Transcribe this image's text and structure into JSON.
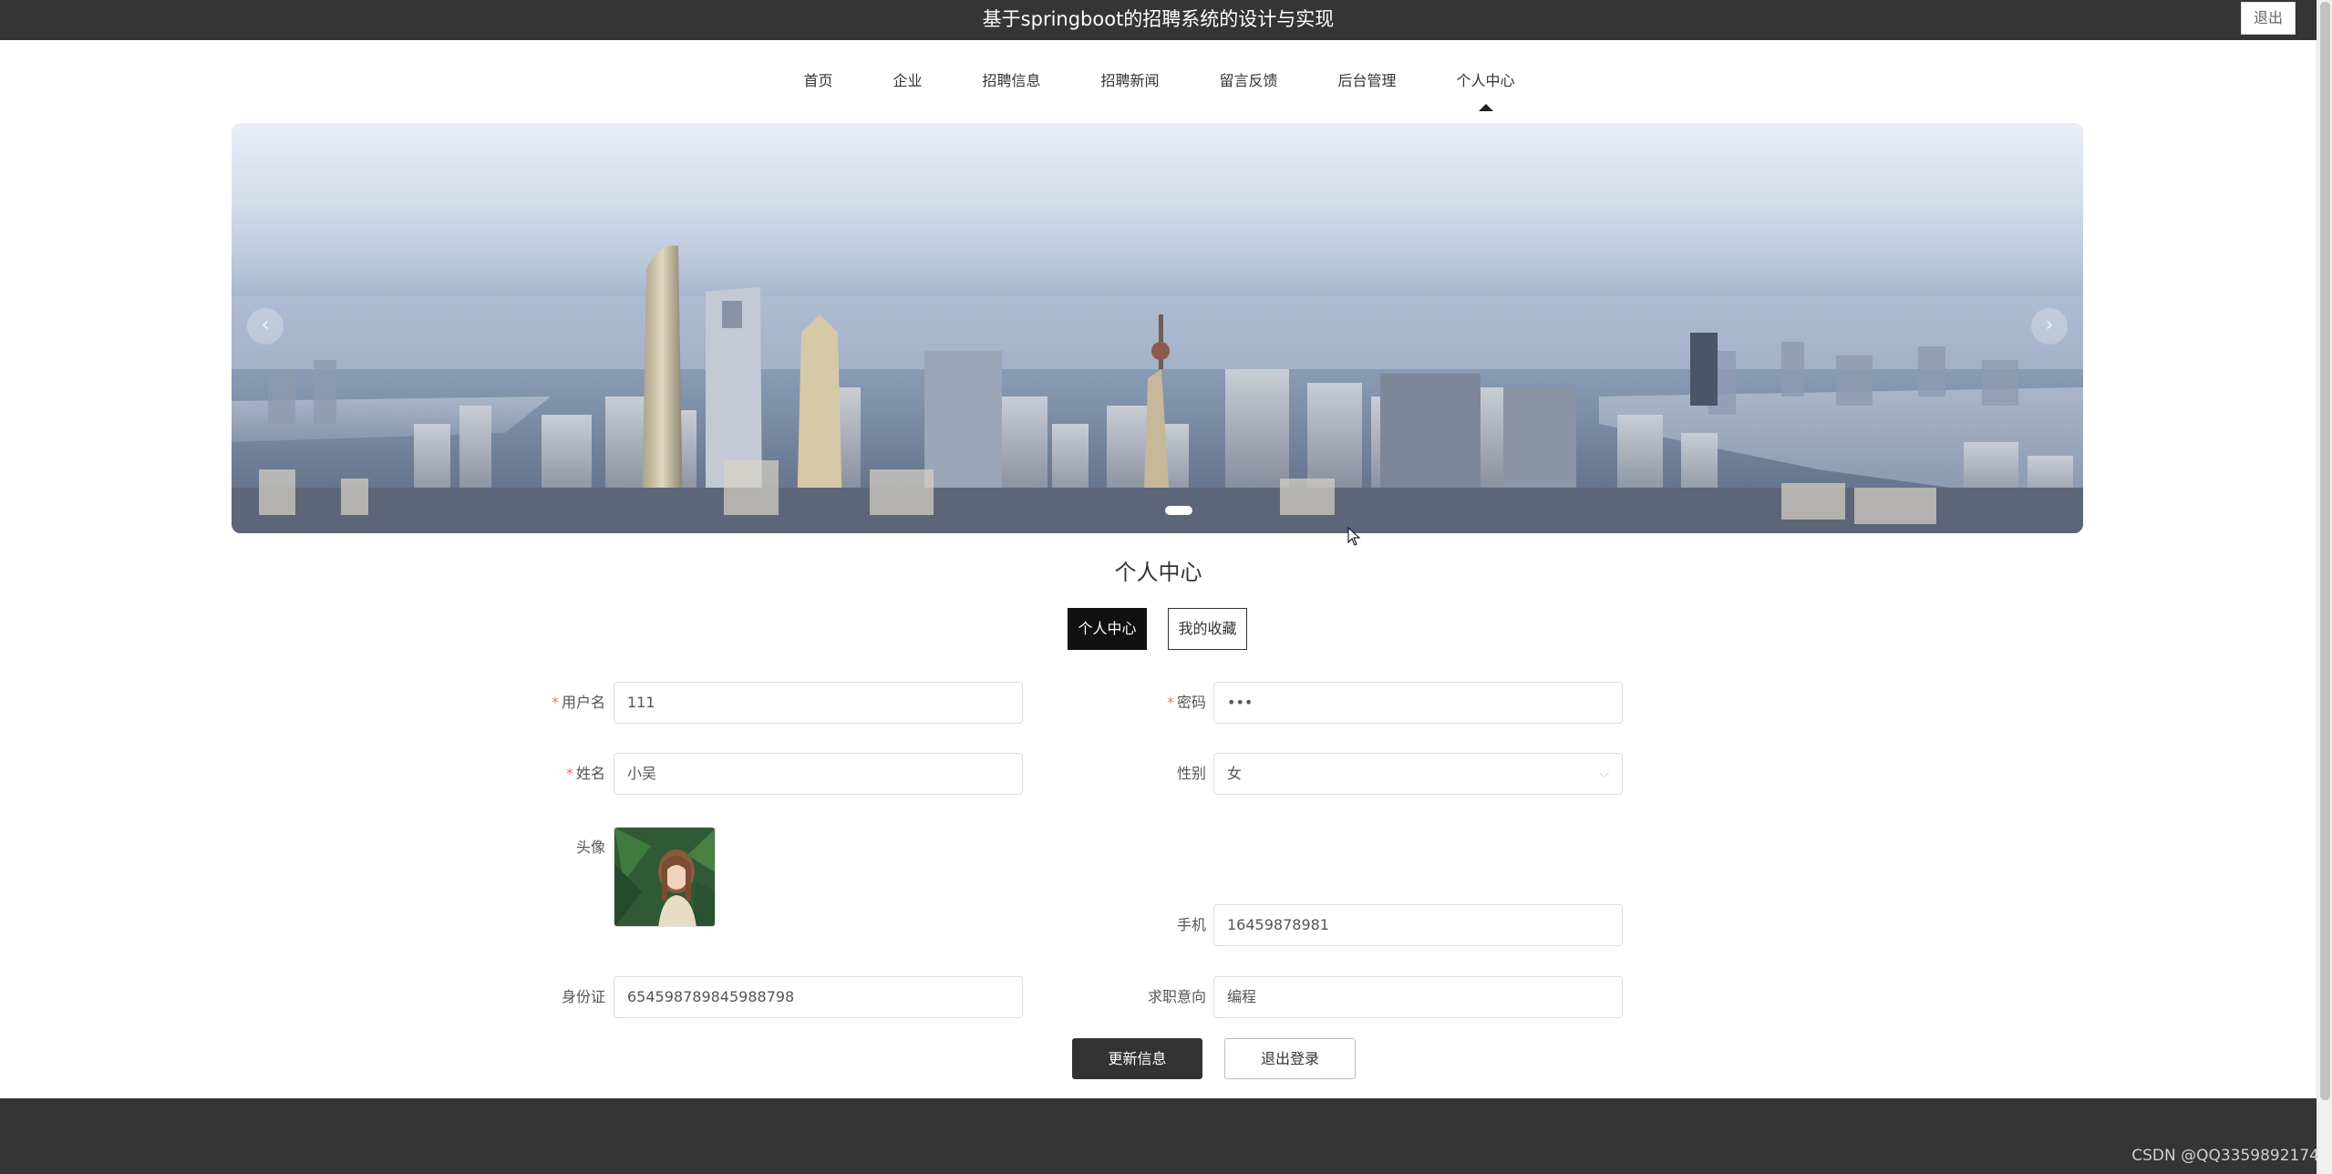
{
  "header": {
    "site_title": "基于springboot的招聘系统的设计与实现",
    "logout_label": "退出"
  },
  "nav": {
    "items": [
      {
        "label": "首页"
      },
      {
        "label": "企业"
      },
      {
        "label": "招聘信息"
      },
      {
        "label": "招聘新闻"
      },
      {
        "label": "留言反馈"
      },
      {
        "label": "后台管理"
      },
      {
        "label": "个人中心"
      }
    ],
    "active_index": 6
  },
  "carousel": {
    "prev_icon": "chevron-left-icon",
    "next_icon": "chevron-right-icon",
    "prev_glyph": "‹",
    "next_glyph": "›",
    "slide_count": 1,
    "active_slide": 1
  },
  "section": {
    "title": "个人中心",
    "tabs": [
      {
        "label": "个人中心",
        "active": true
      },
      {
        "label": "我的收藏",
        "active": false
      }
    ]
  },
  "form": {
    "username": {
      "label": "用户名",
      "value": "111",
      "required": true
    },
    "password": {
      "label": "密码",
      "value": "•••",
      "required": true
    },
    "name": {
      "label": "姓名",
      "value": "小吴",
      "required": true
    },
    "gender": {
      "label": "性别",
      "value": "女",
      "arrow": "⌵"
    },
    "avatar": {
      "label": "头像"
    },
    "phone": {
      "label": "手机",
      "value": "16459878981"
    },
    "id_card": {
      "label": "身份证",
      "value": "654598789845988798"
    },
    "job_intention": {
      "label": "求职意向",
      "value": "编程"
    },
    "required_mark": "*"
  },
  "actions": {
    "update_label": "更新信息",
    "logout_label": "退出登录"
  },
  "watermark": "CSDN @QQ3359892174",
  "colors": {
    "header_bg": "#353535",
    "footer_bg": "#353535",
    "primary_btn": "#333333",
    "required": "#f56c6c"
  }
}
